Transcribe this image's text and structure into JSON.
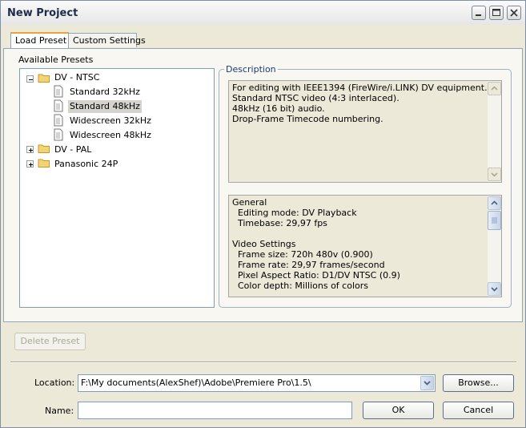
{
  "window": {
    "title": "New Project"
  },
  "tabs": [
    {
      "label": "Load Preset"
    },
    {
      "label": "Custom Settings"
    }
  ],
  "presets": {
    "label": "Available Presets",
    "folders": [
      {
        "label": "DV - NTSC",
        "items": [
          "Standard 32kHz",
          "Standard 48kHz",
          "Widescreen 32kHz",
          "Widescreen 48kHz"
        ],
        "selected": "Standard 48kHz"
      },
      {
        "label": "DV - PAL"
      },
      {
        "label": "Panasonic 24P"
      }
    ]
  },
  "description": {
    "label": "Description",
    "text": "For editing with IEEE1394 (FireWire/i.LINK) DV equipment.\nStandard NTSC video (4:3 interlaced).\n48kHz (16 bit) audio.\nDrop-Frame Timecode numbering.",
    "details": "General\n  Editing mode: DV Playback\n  Timebase: 29,97 fps\n\nVideo Settings\n  Frame size: 720h 480v (0.900)\n  Frame rate: 29,97 frames/second\n  Pixel Aspect Ratio: D1/DV NTSC (0.9)\n  Color depth: Millions of colors"
  },
  "buttons": {
    "delete_preset": "Delete Preset",
    "browse": "Browse...",
    "ok": "OK",
    "cancel": "Cancel"
  },
  "location": {
    "label": "Location:",
    "value": "F:\\My documents(AlexShef)\\Adobe\\Premiere Pro\\1.5\\"
  },
  "name": {
    "label": "Name:",
    "value": ""
  }
}
